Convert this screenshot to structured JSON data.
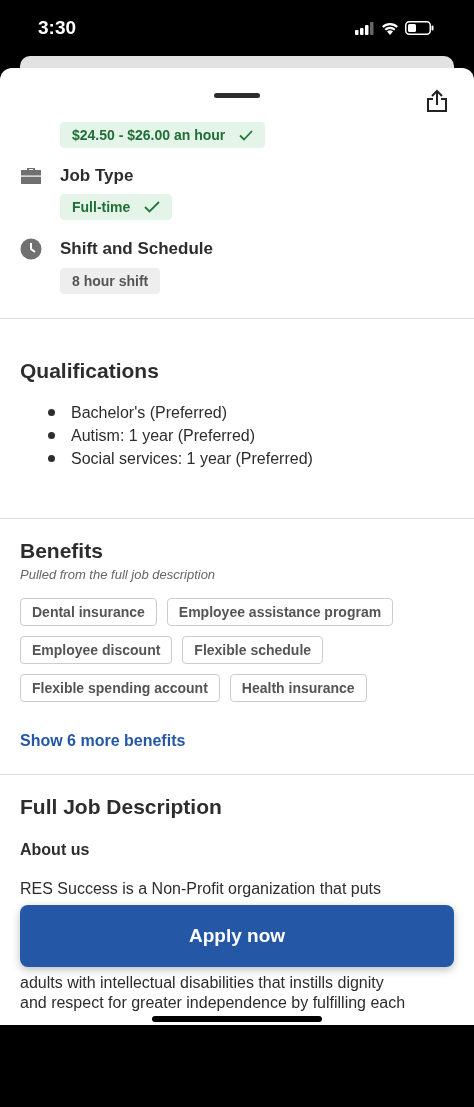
{
  "status_bar": {
    "time": "3:30"
  },
  "pay": {
    "label": "$24.50 - $26.00 an hour",
    "matched": true
  },
  "job_details": [
    {
      "kind": "job-type",
      "title": "Job Type",
      "tags": [
        {
          "label": "Full-time",
          "matched": true
        }
      ]
    },
    {
      "kind": "shift",
      "title": "Shift and Schedule",
      "tags": [
        {
          "label": "8 hour shift",
          "matched": false
        }
      ]
    }
  ],
  "qualifications": {
    "title": "Qualifications",
    "items": [
      "Bachelor's (Preferred)",
      "Autism: 1 year (Preferred)",
      "Social services: 1 year (Preferred)"
    ]
  },
  "benefits": {
    "title": "Benefits",
    "subtitle": "Pulled from the full job description",
    "tags": [
      "Dental insurance",
      "Employee assistance program",
      "Employee discount",
      "Flexible schedule",
      "Flexible spending account",
      "Health insurance"
    ],
    "more_link": "Show 6 more benefits"
  },
  "description": {
    "title": "Full Job Description",
    "subheading": "About us",
    "lines": [
      "RES Success is a Non-Profit organization that puts",
      "adults with intellectual disabilities that instills dignity",
      "and respect for greater independence by fulfilling each"
    ]
  },
  "apply_button": "Apply now"
}
